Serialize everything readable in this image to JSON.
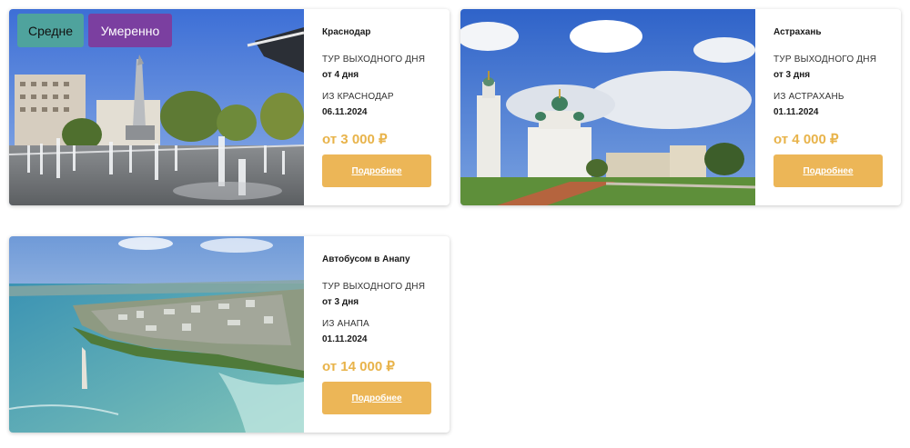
{
  "badges": {
    "difficulty": "Средне",
    "intensity": "Умеренно"
  },
  "colors": {
    "accent": "#e8b34a",
    "button": "#ecb657",
    "badge_difficulty": "#4fa39d",
    "badge_intensity": "#7b3fa0"
  },
  "tours": [
    {
      "title": "Краснодар",
      "type": "ТУР ВЫХОДНОГО ДНЯ",
      "duration": "от 4 дня",
      "from": "ИЗ КРАСНОДАР",
      "date": "06.11.2024",
      "price": "от 3 000 ₽",
      "button": "Подробнее"
    },
    {
      "title": "Астрахань",
      "type": "ТУР ВЫХОДНОГО ДНЯ",
      "duration": "от 3 дня",
      "from": "ИЗ АСТРАХАНЬ",
      "date": "01.11.2024",
      "price": "от 4 000 ₽",
      "button": "Подробнее"
    },
    {
      "title": "Автобусом в Анапу",
      "type": "ТУР ВЫХОДНОГО ДНЯ",
      "duration": "от 3 дня",
      "from": "ИЗ АНАПА",
      "date": "01.11.2024",
      "price": "от 14 000 ₽",
      "button": "Подробнее"
    }
  ]
}
